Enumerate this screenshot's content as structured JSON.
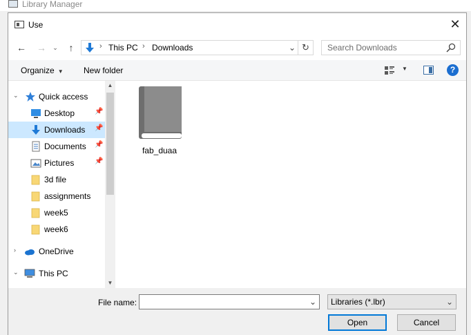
{
  "background_window": {
    "title": "Library Manager"
  },
  "dialog": {
    "title": "Use",
    "close_glyph": "✕"
  },
  "navigation": {
    "back_glyph": "←",
    "forward_glyph": "→",
    "recent_glyph": "⌄",
    "up_glyph": "↑",
    "address": {
      "segments": [
        "This PC",
        "Downloads"
      ],
      "separator": "›",
      "dropdown_glyph": "⌄"
    },
    "refresh_glyph": "↻",
    "search": {
      "placeholder": "Search Downloads"
    }
  },
  "toolbar": {
    "organize_label": "Organize",
    "organize_dd_glyph": "▼",
    "new_folder_label": "New folder",
    "view_dd_glyph": "▼",
    "help_glyph": "?"
  },
  "nav_pane": {
    "items": [
      {
        "label": "Quick access",
        "icon": "star-icon",
        "arrow": "⌄"
      },
      {
        "label": "Desktop",
        "icon": "desktop-icon",
        "pinned": true
      },
      {
        "label": "Downloads",
        "icon": "download-icon",
        "pinned": true,
        "selected": true
      },
      {
        "label": "Documents",
        "icon": "documents-icon",
        "pinned": true
      },
      {
        "label": "Pictures",
        "icon": "pictures-icon",
        "pinned": true
      },
      {
        "label": "3d file",
        "icon": "folder-icon"
      },
      {
        "label": "assignments",
        "icon": "folder-icon"
      },
      {
        "label": "week5",
        "icon": "folder-icon"
      },
      {
        "label": "week6",
        "icon": "folder-icon"
      },
      {
        "label": "OneDrive",
        "icon": "cloud-icon",
        "arrow": "›"
      },
      {
        "label": "This PC",
        "icon": "computer-icon",
        "arrow": "⌄"
      }
    ],
    "pin_glyph": "📌",
    "scroll_up_glyph": "▲",
    "scroll_down_glyph": "▼"
  },
  "files": [
    {
      "name": "fab_duaa",
      "icon": "book-icon"
    }
  ],
  "footer": {
    "file_name_label": "File name:",
    "file_name_value": "",
    "file_name_dd_glyph": "⌄",
    "file_type": "Libraries (*.lbr)",
    "file_type_dd_glyph": "⌄",
    "open_label": "Open",
    "cancel_label": "Cancel"
  },
  "colors": {
    "selection": "#cce8ff",
    "accent": "#0078d7",
    "help": "#1b6ed0",
    "folder": "#f8d775",
    "book": "#6e6e6e"
  }
}
